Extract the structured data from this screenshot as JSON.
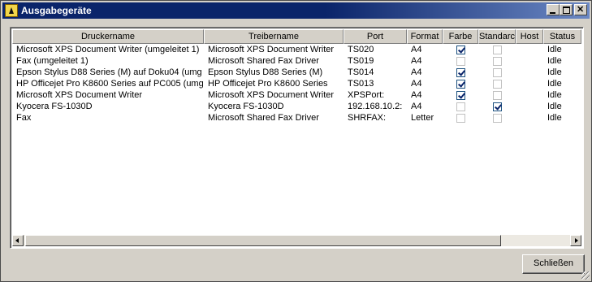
{
  "window": {
    "title": "Ausgabegeräte",
    "icon": "app-icon"
  },
  "table": {
    "columns": [
      "Druckername",
      "Treibername",
      "Port",
      "Format",
      "Farbe",
      "Standarc",
      "Host",
      "Status"
    ],
    "rows": [
      {
        "druckername": "Microsoft XPS Document Writer (umgeleitet 1)",
        "treibername": "Microsoft XPS Document Writer",
        "port": "TS020",
        "format": "A4",
        "farbe": true,
        "standard": false,
        "host": "",
        "status": "Idle"
      },
      {
        "druckername": "Fax (umgeleitet 1)",
        "treibername": "Microsoft Shared Fax Driver",
        "port": "TS019",
        "format": "A4",
        "farbe": false,
        "standard": false,
        "host": "",
        "status": "Idle"
      },
      {
        "druckername": "Epson Stylus D88 Series (M) auf Doku04 (umg",
        "treibername": "Epson Stylus D88 Series (M)",
        "port": "TS014",
        "format": "A4",
        "farbe": true,
        "standard": false,
        "host": "",
        "status": "Idle"
      },
      {
        "druckername": "HP Officejet Pro K8600 Series auf PC005 (umg",
        "treibername": "HP Officejet Pro K8600 Series",
        "port": "TS013",
        "format": "A4",
        "farbe": true,
        "standard": false,
        "host": "",
        "status": "Idle"
      },
      {
        "druckername": "Microsoft XPS Document Writer",
        "treibername": "Microsoft XPS Document Writer",
        "port": "XPSPort:",
        "format": "A4",
        "farbe": true,
        "standard": false,
        "host": "",
        "status": "Idle"
      },
      {
        "druckername": "Kyocera FS-1030D",
        "treibername": "Kyocera FS-1030D",
        "port": "192.168.10.2:",
        "format": "A4",
        "farbe": false,
        "standard": true,
        "host": "",
        "status": "Idle"
      },
      {
        "druckername": "Fax",
        "treibername": "Microsoft Shared Fax Driver",
        "port": "SHRFAX:",
        "format": "Letter",
        "farbe": false,
        "standard": false,
        "host": "",
        "status": "Idle"
      }
    ]
  },
  "buttons": {
    "close_label": "Schließen"
  },
  "colors": {
    "titlebar": "#0a246a",
    "face": "#d4d0c8"
  }
}
